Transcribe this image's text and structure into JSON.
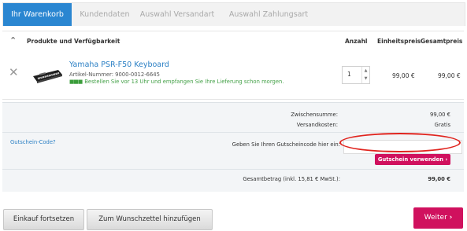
{
  "tabs": [
    {
      "label": "Ihr Warenkorb"
    },
    {
      "label": "Kundendaten"
    },
    {
      "label": "Auswahl Versandart"
    },
    {
      "label": "Auswahl Zahlungsart"
    }
  ],
  "table_header": {
    "products": "Produkte und Verfügbarkeit",
    "quantity": "Anzahl",
    "unit_price": "Einheitspreis",
    "total_price": "Gesamtpreis"
  },
  "product": {
    "name": "Yamaha PSR-F50 Keyboard",
    "article_number": "Artikel-Nummer: 9000-0012-6645",
    "delivery_info": "Bestellen Sie vor 13 Uhr und empfangen Sie Ihre Lieferung schon morgen.",
    "quantity": "1",
    "unit_price": "99,00 €",
    "total_price": "99,00 €"
  },
  "summary": {
    "subtotal_label": "Zwischensumme:",
    "subtotal_value": "99,00 €",
    "shipping_label": "Versandkosten:",
    "shipping_value": "Gratis",
    "voucher_link": "Gutschein-Code?",
    "voucher_prompt": "Geben Sie Ihren Gutscheincode hier ein:",
    "voucher_input_value": "",
    "voucher_button": "Gutschein verwenden",
    "total_label": "Gesamtbetrag (inkl. 15,81 € MwSt.):",
    "total_value": "99,00 €"
  },
  "actions": {
    "continue_shopping": "Einkauf fortsetzen",
    "add_wishlist": "Zum Wunschzettel hinzufügen",
    "next": "Weiter"
  },
  "colors": {
    "accent_blue": "#2a86d1",
    "cta_pink": "#d0115e",
    "annotation_red": "#e0241e",
    "availability_green": "#43a047"
  }
}
